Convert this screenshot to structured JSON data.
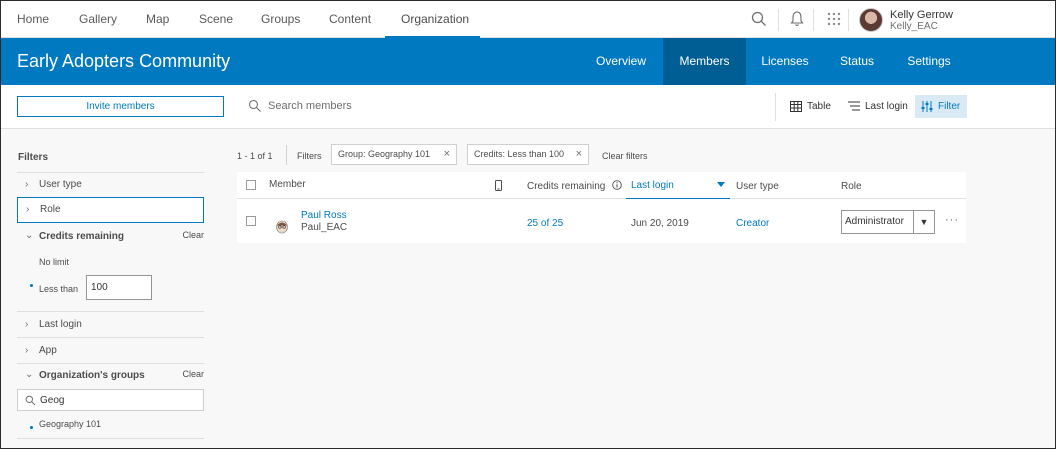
{
  "topnav": {
    "items": [
      {
        "label": "Home"
      },
      {
        "label": "Gallery"
      },
      {
        "label": "Map"
      },
      {
        "label": "Scene"
      },
      {
        "label": "Groups"
      },
      {
        "label": "Content"
      },
      {
        "label": "Organization",
        "active": true
      }
    ],
    "user": {
      "name": "Kelly Gerrow",
      "username": "Kelly_EAC"
    },
    "icons": [
      "search-icon",
      "bell-icon",
      "app-launcher-icon"
    ]
  },
  "header": {
    "org_name": "Early Adopters Community",
    "tabs": [
      {
        "label": "Overview"
      },
      {
        "label": "Members",
        "active": true
      },
      {
        "label": "Licenses"
      },
      {
        "label": "Status"
      },
      {
        "label": "Settings"
      }
    ]
  },
  "toolbar": {
    "invite_label": "Invite members",
    "search_placeholder": "Search members",
    "table_label": "Table",
    "sort_label": "Last login",
    "filter_label": "Filter"
  },
  "sidebar": {
    "title": "Filters",
    "user_type": "User type",
    "role": "Role",
    "credits": {
      "label": "Credits remaining",
      "clear": "Clear",
      "no_limit": "No limit",
      "less_than": "Less than",
      "less_than_value": "100"
    },
    "last_login": "Last login",
    "app": "App",
    "groups": {
      "label": "Organization's groups",
      "clear": "Clear",
      "search_value": "Geog",
      "option": "Geography 101"
    }
  },
  "results": {
    "count": "1 - 1 of 1",
    "filters_label": "Filters",
    "chips": [
      "Group: Geography 101",
      "Credits: Less than 100"
    ],
    "clear_filters": "Clear filters"
  },
  "table": {
    "headers": {
      "member": "Member",
      "credits": "Credits remaining",
      "last_login": "Last login",
      "user_type": "User type",
      "role": "Role"
    },
    "rows": [
      {
        "name": "Paul Ross",
        "username": "Paul_EAC",
        "credits": "25 of 25",
        "last_login": "Jun 20, 2019",
        "user_type": "Creator",
        "role": "Administrator"
      }
    ]
  },
  "colors": {
    "brand_blue": "#0079c1",
    "active_tab": "#005e95"
  }
}
